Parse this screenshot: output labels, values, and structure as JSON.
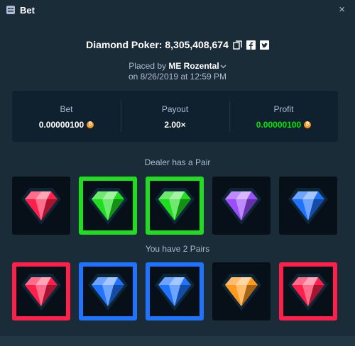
{
  "modal": {
    "title": "Bet",
    "close_label": "×"
  },
  "headline": {
    "text": "Diamond Poker: 8,305,408,674",
    "icons": [
      "copy-icon",
      "facebook-icon",
      "twitter-icon"
    ]
  },
  "placed": {
    "prefix": "Placed by",
    "user": "ME Rozental",
    "date": "on 8/26/2019 at 12:59 PM"
  },
  "stats": [
    {
      "label": "Bet",
      "value": "0.00000100",
      "currency_icon": "bitcoin-icon"
    },
    {
      "label": "Payout",
      "value": "2.00×"
    },
    {
      "label": "Profit",
      "value": "0.00000100",
      "currency_icon": "bitcoin-icon",
      "color": "#00e701"
    }
  ],
  "dealer": {
    "title": "Dealer has a Pair",
    "gems": [
      "red",
      "green",
      "green",
      "purple",
      "blue"
    ],
    "highlighted": [
      false,
      true,
      true,
      false,
      false
    ]
  },
  "player": {
    "title": "You have 2 Pairs",
    "gems": [
      "red",
      "blue",
      "blue",
      "orange",
      "red"
    ],
    "highlighted": [
      true,
      true,
      true,
      false,
      true
    ]
  },
  "colors": {
    "background": "#1a2c38",
    "panel": "#0f212e",
    "muted_text": "#b1bad3",
    "profit_green": "#00e701",
    "gem_red": "#ff1f4b",
    "gem_green": "#1fde1f",
    "gem_blue": "#1f73ff",
    "gem_purple": "#9b4dff",
    "gem_orange": "#ff9a1f",
    "card_background": "#071019"
  }
}
